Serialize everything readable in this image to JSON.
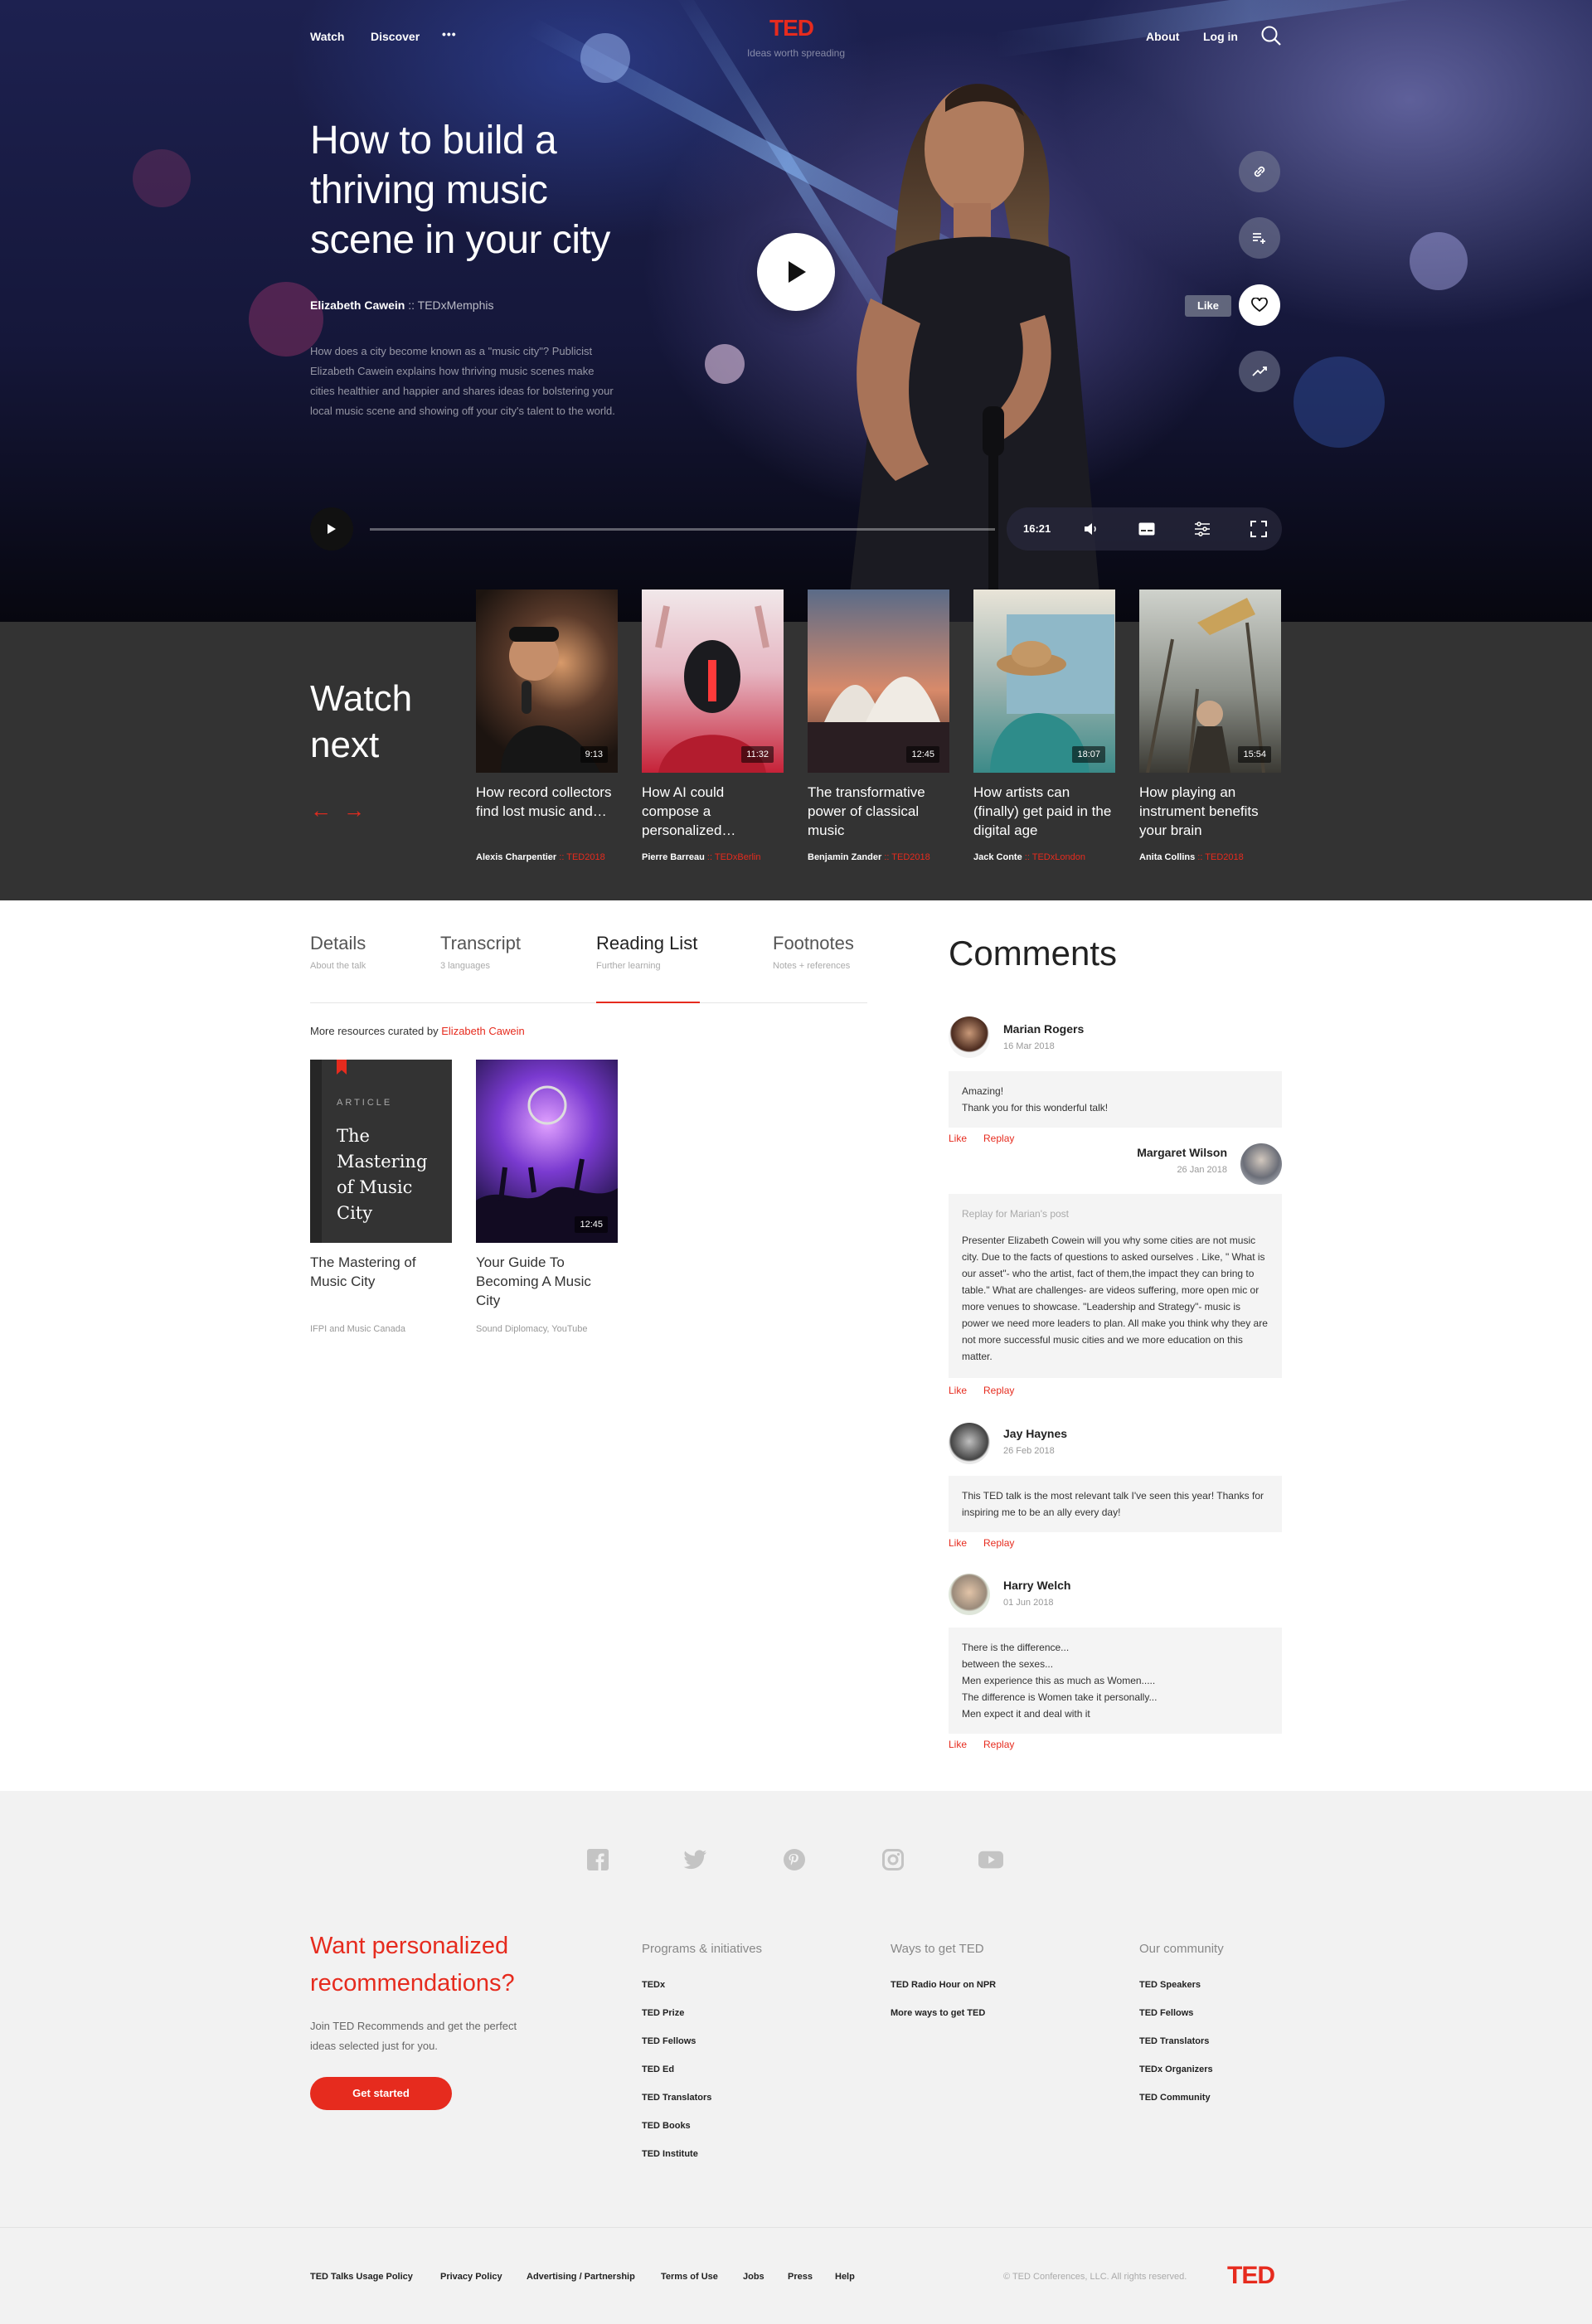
{
  "nav": {
    "watch": "Watch",
    "discover": "Discover",
    "more": "•••",
    "logo": "TED",
    "tagline": "Ideas worth spreading",
    "about": "About",
    "login": "Log in"
  },
  "talk": {
    "title": "How to build a thriving music scene in your city",
    "speaker": "Elizabeth Cawein",
    "separator": "::",
    "event": "TEDxMemphis",
    "description": "How does a city become known as a \"music city\"? Publicist Elizabeth Cawein explains how thriving music scenes make cities healthier and happier and shares ideas for bolstering your local music scene and showing off your city's talent to the world.",
    "like_label": "Like",
    "duration": "16:21",
    "progress": 0
  },
  "watch_next": {
    "heading": "Watch next",
    "items": [
      {
        "title": "How record collectors find lost music and…",
        "speaker": "Alexis Charpentier",
        "event": "TED2018",
        "duration": "9:13"
      },
      {
        "title": "How AI could compose a personalized…",
        "speaker": "Pierre Barreau",
        "event": "TEDxBerlin",
        "duration": "11:32"
      },
      {
        "title": "The transformative power of classical music",
        "speaker": "Benjamin Zander",
        "event": "TED2018",
        "duration": "12:45"
      },
      {
        "title": "How artists can (finally) get paid in the digital age",
        "speaker": "Jack Conte",
        "event": "TEDxLondon",
        "duration": "18:07"
      },
      {
        "title": "How playing an instrument benefits your brain",
        "speaker": "Anita Collins",
        "event": "TED2018",
        "duration": "15:54"
      }
    ]
  },
  "tabs": [
    {
      "label": "Details",
      "sub": "About the talk"
    },
    {
      "label": "Transcript",
      "sub": "3 languages"
    },
    {
      "label": "Reading List",
      "sub": "Further learning"
    },
    {
      "label": "Footnotes",
      "sub": "Notes + references"
    }
  ],
  "reading_list": {
    "curated_prefix": "More resources curated by",
    "curator": "Elizabeth Cawein",
    "items": [
      {
        "type": "ARTICLE",
        "cover_title": "The Mastering of Music City",
        "title": "The Mastering of Music City",
        "source": "IFPI and Music Canada"
      },
      {
        "title": "Your Guide To Becoming A Music City",
        "source": "Sound Diplomacy, YouTube",
        "duration": "12:45"
      }
    ]
  },
  "comments": {
    "heading": "Comments",
    "like": "Like",
    "reply": "Replay",
    "items": [
      {
        "name": "Marian Rogers",
        "date": "16 Mar 2018",
        "text": "Amazing!\nThank you for this wonderful talk!"
      },
      {
        "name": "Margaret Wilson",
        "date": "26 Jan 2018",
        "reply_to": "Replay for Marian's post",
        "text": "Presenter Elizabeth Cowein will you why some cities are not music city. Due to the facts of questions to asked ourselves . Like, \" What is our asset\"- who the artist, fact of them,the impact they can bring to table.\" What are challenges- are videos suffering, more open mic or more venues to showcase. \"Leadership and Strategy\"- music is power we need more leaders to plan. All make you think why they are not more successful music cities and we more education on this matter."
      },
      {
        "name": "Jay Haynes",
        "date": "26 Feb 2018",
        "text": "This TED talk is the most relevant talk I've seen this year! Thanks for inspiring me to be an ally every day!"
      },
      {
        "name": "Harry Welch",
        "date": "01 Jun 2018",
        "text": "There is the difference...\nbetween the sexes...\nMen experience this as much as Women.....\nThe difference is Women take it personally...\nMen expect it and deal with it"
      }
    ]
  },
  "footer": {
    "social": [
      "facebook-icon",
      "twitter-icon",
      "pinterest-icon",
      "instagram-icon",
      "youtube-icon"
    ],
    "promo_title": "Want personalized recommendations?",
    "promo_text": "Join TED Recommends and get the perfect ideas selected just for you.",
    "cta": "Get started",
    "columns": [
      {
        "heading": "Programs & initiatives",
        "links": [
          "TEDx",
          "TED Prize",
          "TED Fellows",
          "TED Ed",
          "TED Translators",
          "TED Books",
          "TED Institute"
        ]
      },
      {
        "heading": "Ways to get TED",
        "links": [
          "TED Radio Hour on NPR",
          "More ways to get TED"
        ]
      },
      {
        "heading": "Our community",
        "links": [
          "TED Speakers",
          "TED Fellows",
          "TED Translators",
          "TEDx Organizers",
          "TED Community"
        ]
      }
    ],
    "legal": [
      "TED Talks Usage Policy",
      "Privacy Policy",
      "Advertising / Partnership",
      "Terms of Use",
      "Jobs",
      "Press",
      "Help"
    ],
    "copyright": "© TED Conferences, LLC. All rights reserved.",
    "logo": "TED"
  },
  "colors": {
    "accent": "#e62b1e",
    "band": "#333333",
    "footer_bg": "#f2f2f2"
  }
}
